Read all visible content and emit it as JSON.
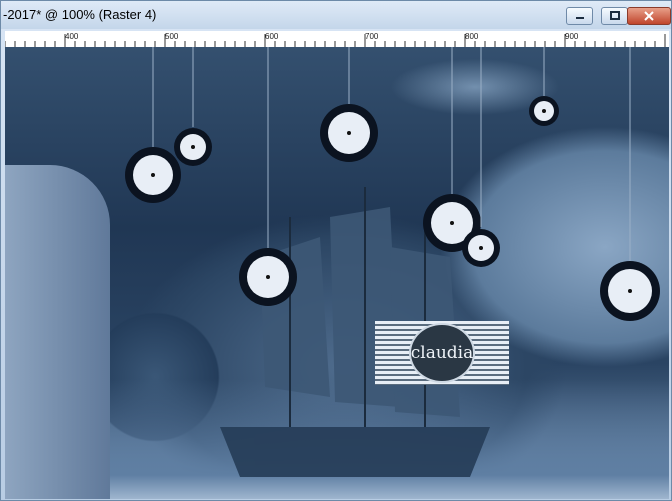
{
  "window": {
    "title": "-2017* @ 100% (Raster 4)",
    "buttons": [
      "minimize",
      "maximize",
      "close"
    ]
  },
  "ruler": {
    "labels": [
      "400",
      "500",
      "600",
      "700",
      "800",
      "900"
    ]
  },
  "canvas": {
    "watermark_text": "claudia"
  },
  "colors": {
    "title_bar": "#c4d6ea",
    "close_button": "#c0452b",
    "canvas_tint": "#2c4664"
  }
}
